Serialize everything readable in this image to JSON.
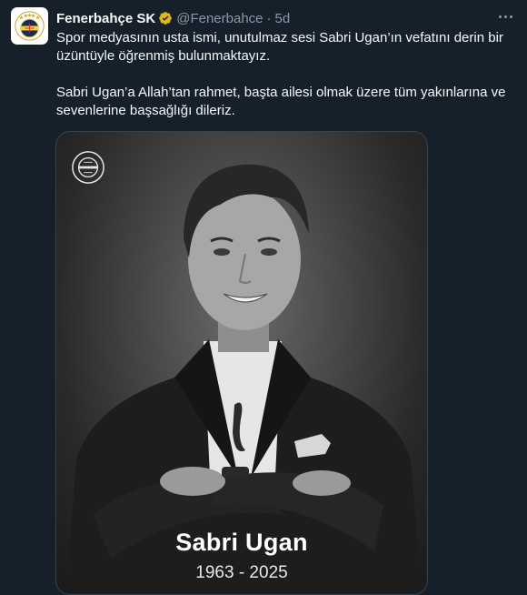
{
  "tweet": {
    "display_name": "Fenerbahçe SK",
    "handle": "@Fenerbahce",
    "separator": "·",
    "time": "5d",
    "text": "Spor medyasının usta ismi, unutulmaz sesi Sabri Ugan’ın vefatını derin bir üzüntüyle öğrenmiş bulunmaktayız.\n\nSabri Ugan’a Allah’tan rahmet, başta ailesi olmak üzere tüm yakınlarına ve sevenlerine başsağlığı dileriz."
  },
  "media": {
    "name": "Sabri Ugan",
    "years": "1963 - 2025"
  },
  "icons": {
    "verified": "verified-badge-gold",
    "more": "more-horizontal",
    "avatar": "fenerbahce-crest"
  },
  "colors": {
    "background": "#15202b",
    "text": "#f7f9f9",
    "secondary_text": "#8b98a5",
    "verified_gold": "#e2b719",
    "club_yellow": "#f4d03f",
    "club_navy": "#1a2a5a"
  }
}
